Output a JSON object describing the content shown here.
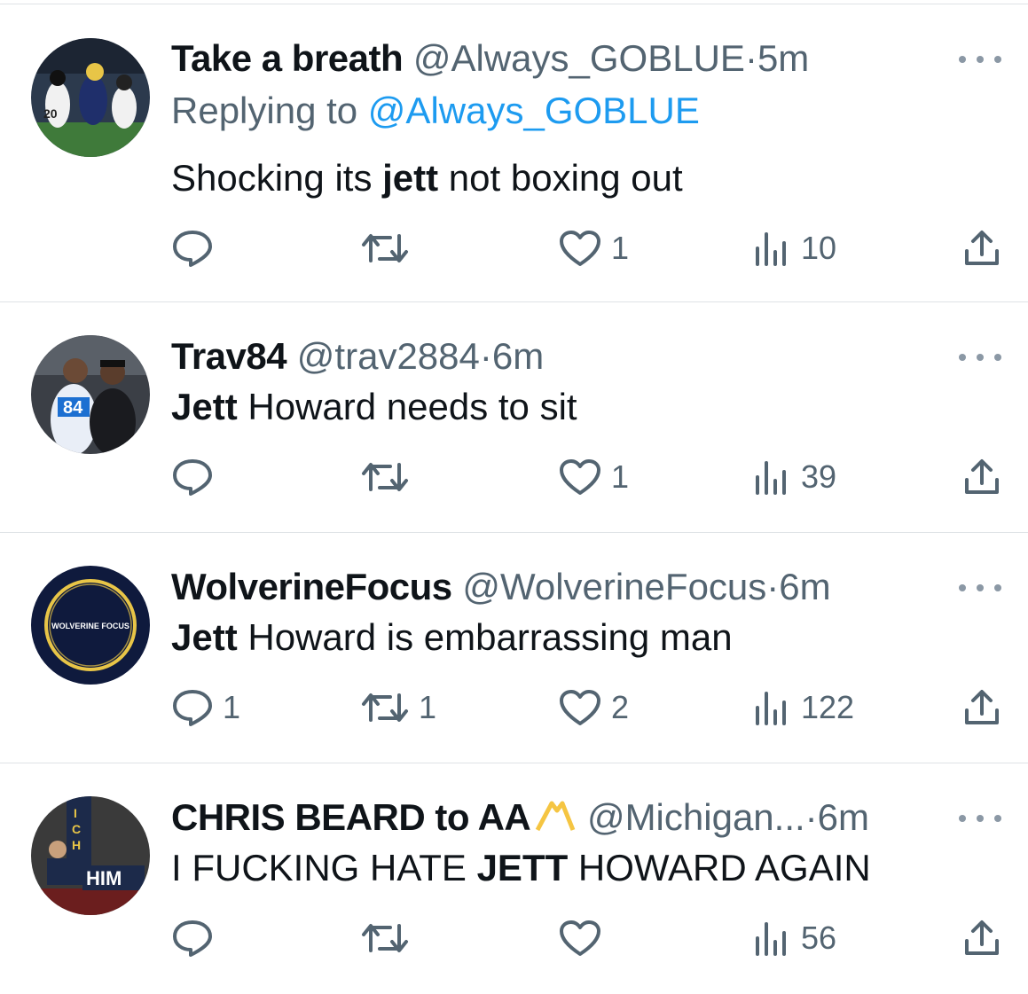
{
  "tweets": [
    {
      "name": "Take a breath",
      "handle": "@Always_GOBLUE",
      "dot": "·",
      "time": "5m",
      "replying_prefix": "Replying to ",
      "replying_handle": "@Always_GOBLUE",
      "text_before": "Shocking its ",
      "text_bold": "jett",
      "text_after": " not boxing out",
      "counts": {
        "reply": "",
        "retweet": "",
        "like": "1",
        "views": "10"
      },
      "avatar_icon": "football-player-photo"
    },
    {
      "name": "Trav84",
      "handle": "@trav2884",
      "dot": "·",
      "time": "6m",
      "text_before": "",
      "text_bold": "Jett",
      "text_after": " Howard needs to sit",
      "counts": {
        "reply": "",
        "retweet": "",
        "like": "1",
        "views": "39"
      },
      "avatar_icon": "two-people-photo"
    },
    {
      "name": "WolverineFocus",
      "handle": "@WolverineFocus",
      "dot": "·",
      "time": "6m",
      "text_before": "",
      "text_bold": "Jett",
      "text_after": " Howard is embarrassing man",
      "counts": {
        "reply": "1",
        "retweet": "1",
        "like": "2",
        "views": "122"
      },
      "avatar_logo_text": "WOLVERINE FOCUS"
    },
    {
      "name": "CHRIS BEARD to AA",
      "handle": "@Michigan...",
      "dot": "·",
      "time": "6m",
      "text_before": "I FUCKING HATE ",
      "text_bold": "JETT",
      "text_after": " HOWARD AGAIN",
      "counts": {
        "reply": "",
        "retweet": "",
        "like": "",
        "views": "56"
      },
      "avatar_sign_text": "HIM",
      "avatar_banner_text": "ICH"
    }
  ],
  "colors": {
    "text": "#0f1419",
    "secondary": "#536471",
    "link": "#1d9bf0",
    "divider": "#dfe3e6",
    "gold": "#f5c542"
  },
  "icons": [
    "reply-icon",
    "retweet-icon",
    "like-icon",
    "views-icon",
    "share-icon",
    "more-icon",
    "folded-hands-emoji"
  ]
}
